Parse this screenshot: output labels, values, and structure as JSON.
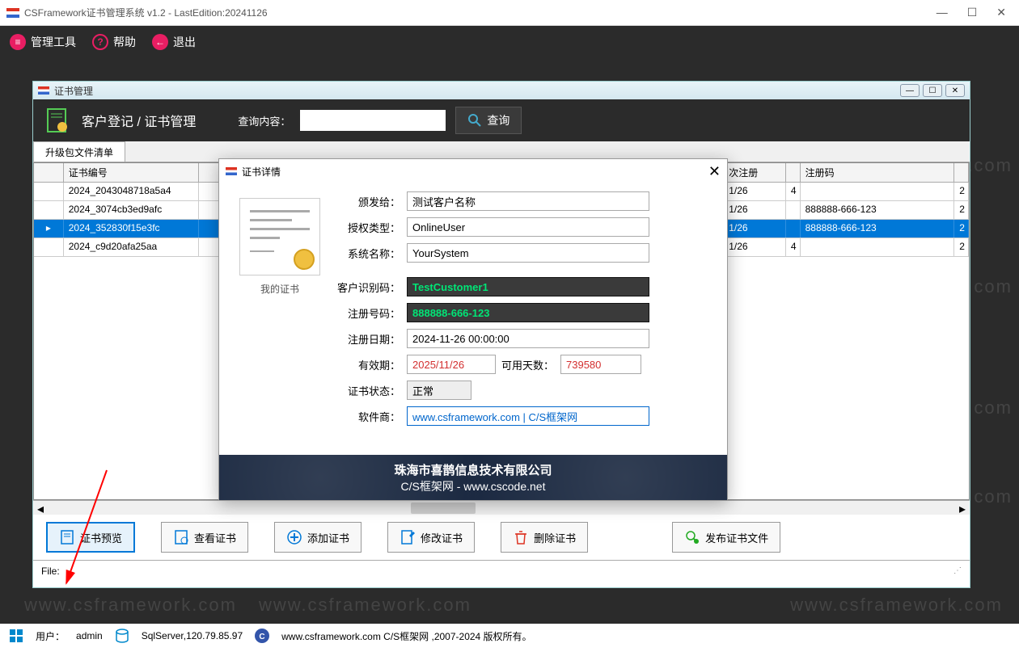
{
  "window": {
    "title": "CSFramework证书管理系统 v1.2 - LastEdition:20241126"
  },
  "menu": {
    "tools": "管理工具",
    "help": "帮助",
    "exit": "退出"
  },
  "subwindow": {
    "title": "证书管理",
    "header_title": "客户登记 / 证书管理",
    "search_label": "查询内容：",
    "search_value": "",
    "search_btn": "查询",
    "tab": "升级包文件清单",
    "file_label": "File:"
  },
  "grid": {
    "headers": {
      "cert_no": "证书编号",
      "next_reg": "次注册",
      "reg_code": "注册码"
    },
    "rows": [
      {
        "cert_no": "2024_2043048718a5a4",
        "next_reg": "1/26",
        "code_count": "4",
        "rc": "2"
      },
      {
        "cert_no": "2024_3074cb3ed9afc",
        "next_reg": "1/26",
        "reg_code": "888888-666-123",
        "rc": "2"
      },
      {
        "cert_no": "2024_352830f15e3fc",
        "next_reg": "1/26",
        "reg_code": "888888-666-123",
        "rc": "2",
        "selected": true
      },
      {
        "cert_no": "2024_c9d20afa25aa",
        "next_reg": "1/26",
        "code_count": "4",
        "rc": "2"
      }
    ]
  },
  "buttons": {
    "preview": "证书预览",
    "view": "查看证书",
    "add": "添加证书",
    "edit": "修改证书",
    "del": "删除证书",
    "publish": "发布证书文件"
  },
  "status": {
    "user_label": "用户：",
    "user": "admin",
    "db": "SqlServer,120.79.85.97",
    "copyright": "www.csframework.com C/S框架网 ,2007-2024 版权所有。"
  },
  "dialog": {
    "title": "证书详情",
    "side_caption": "我的证书",
    "labels": {
      "issued_to": "颁发给：",
      "auth_type": "授权类型：",
      "sys_name": "系统名称：",
      "cust_id": "客户识别码：",
      "reg_no": "注册号码：",
      "reg_date": "注册日期：",
      "expiry": "有效期：",
      "days_left": "可用天数：",
      "status": "证书状态：",
      "vendor": "软件商："
    },
    "values": {
      "issued_to": "测试客户名称",
      "auth_type": "OnlineUser",
      "sys_name": "YourSystem",
      "cust_id": "TestCustomer1",
      "reg_no": "888888-666-123",
      "reg_date": "2024-11-26 00:00:00",
      "expiry": "2025/11/26",
      "days_left": "739580",
      "status": "正常",
      "vendor": "www.csframework.com | C/S框架网"
    },
    "footer": {
      "line1": "珠海市喜鹊信息技术有限公司",
      "line2": "C/S框架网 - www.cscode.net"
    }
  },
  "watermark": "www.csframework.com"
}
